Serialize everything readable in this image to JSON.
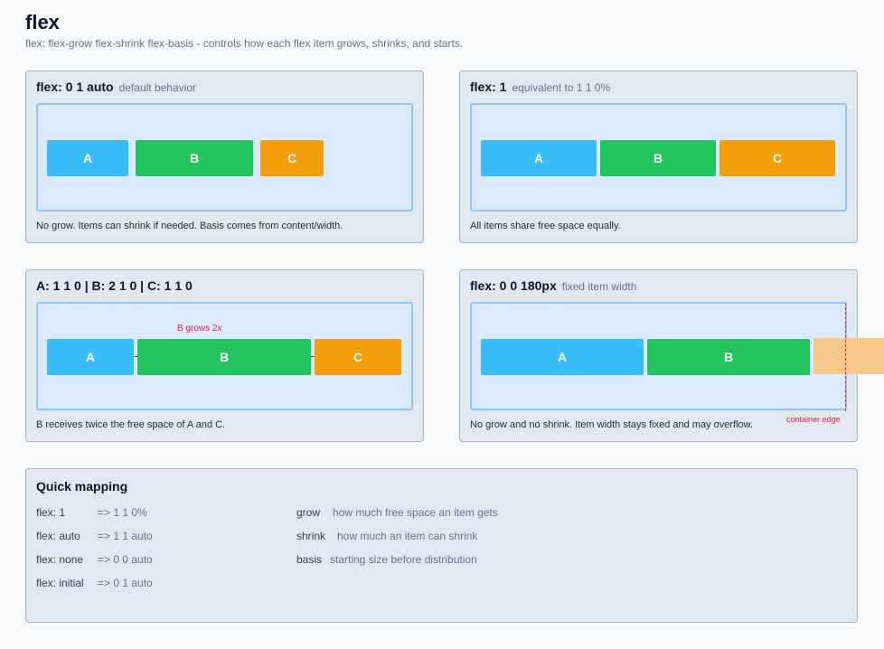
{
  "header": {
    "title": "flex",
    "subtitle": "flex: flex-grow flex-shrink flex-basis - controls how each flex item grows, shrinks, and starts."
  },
  "examples": [
    {
      "title": "flex: 0 1 auto",
      "subtitle": "default behavior",
      "caption": "No grow. Items can shrink if needed. Basis comes from content/width.",
      "items": [
        "A",
        "B",
        "C"
      ]
    },
    {
      "title": "flex: 1",
      "subtitle": "equivalent to 1 1 0%",
      "caption": "All items share free space equally.",
      "items": [
        "A",
        "B",
        "C"
      ]
    },
    {
      "title": "A: 1 1 0 | B: 2 1 0 | C: 1 1 0",
      "subtitle": "",
      "caption": "B receives twice the free space of A and C.",
      "note": "B grows 2x",
      "items": [
        "A",
        "B",
        "C"
      ]
    },
    {
      "title": "flex: 0 0 180px",
      "subtitle": "fixed item width",
      "caption": "No grow and no shrink. Item width stays fixed and may overflow.",
      "edge_label": "container edge",
      "items": [
        "A",
        "B"
      ]
    }
  ],
  "mapping": {
    "title": "Quick mapping",
    "shorthands": [
      {
        "key": "flex: 1",
        "value": "=> 1 1 0%"
      },
      {
        "key": "flex: auto",
        "value": "=> 1 1 auto"
      },
      {
        "key": "flex: none",
        "value": "=> 0 0 auto"
      },
      {
        "key": "flex: initial",
        "value": "=> 0 1 auto"
      }
    ],
    "terms": [
      {
        "key": "grow",
        "value": "how much free space an item gets"
      },
      {
        "key": "shrink",
        "value": "how much an item can shrink"
      },
      {
        "key": "basis",
        "value": "starting size before distribution"
      }
    ]
  },
  "colors": {
    "item_a": "#38bdf8",
    "item_b": "#22c55e",
    "item_c": "#f59e0b",
    "highlight": "#e11d48"
  }
}
